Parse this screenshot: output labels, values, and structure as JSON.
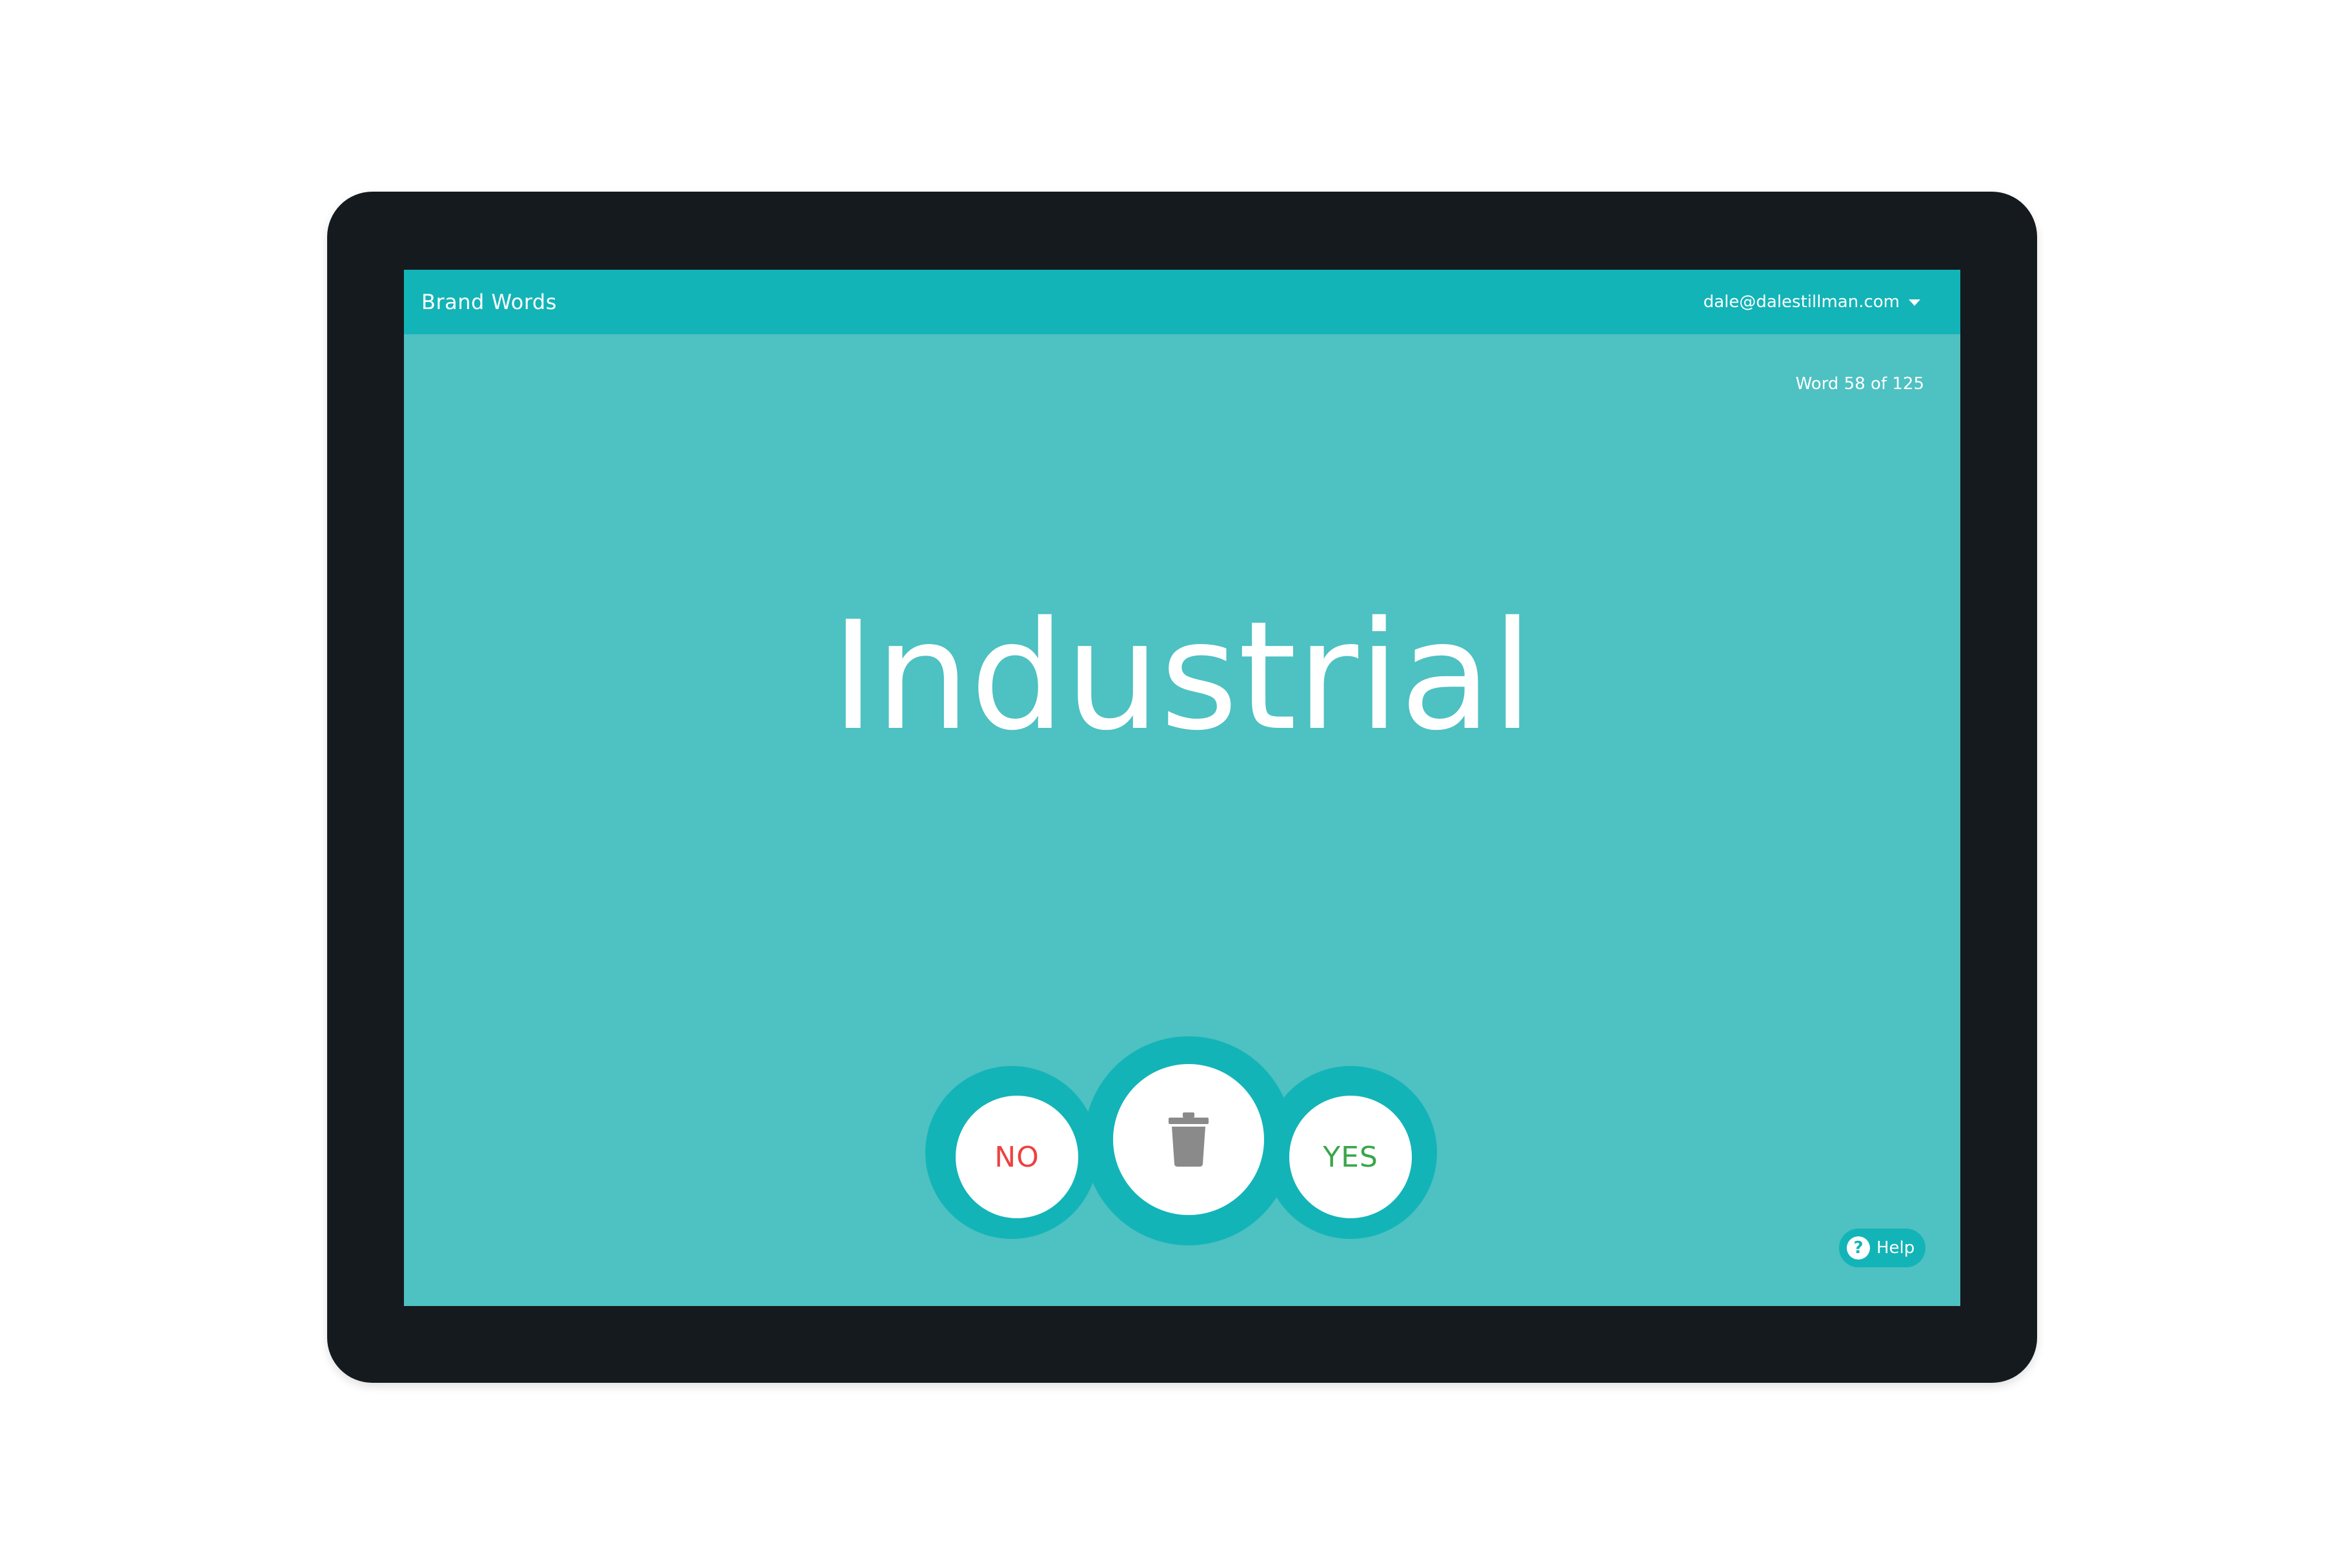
{
  "app": {
    "title": "Brand Words",
    "account_email": "dale@dalestillman.com"
  },
  "progress": {
    "label": "Word 58 of 125",
    "current": 58,
    "total": 125
  },
  "card": {
    "word": "Industrial"
  },
  "actions": {
    "no_label": "NO",
    "yes_label": "YES",
    "delete_icon": "trash-icon"
  },
  "help": {
    "label": "Help",
    "icon_glyph": "?"
  },
  "colors": {
    "header": "#13b4b7",
    "background": "#4ec1c2",
    "no": "#ee4141",
    "yes": "#3aa64b",
    "device_bezel": "#151a1e"
  }
}
